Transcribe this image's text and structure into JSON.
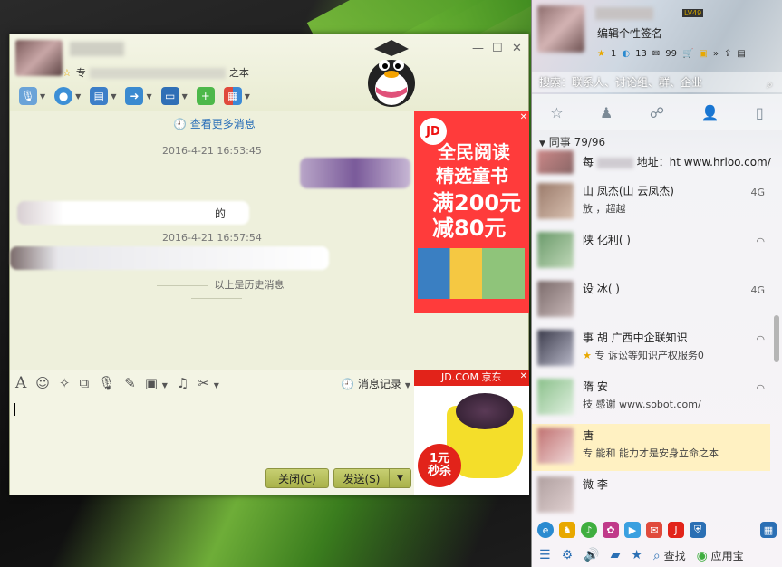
{
  "chat": {
    "signature_prefix": "专",
    "signature_suffix": "之本",
    "more_messages": "查看更多消息",
    "timestamps": [
      "2016-4-21 16:53:45",
      "2016-4-21 16:57:54"
    ],
    "received_fragment": "的",
    "history_divider": "以上是历史消息",
    "message_record": "消息记录",
    "close_label": "关闭(C)",
    "send_label": "发送(S)"
  },
  "ads": {
    "ad1": {
      "logo": "JD",
      "line1": "全民阅读",
      "line2": "精选童书",
      "line3": "满200元",
      "line4": "减80元"
    },
    "ad2": {
      "header": "JD.COM 京东",
      "badge_line1": "1元",
      "badge_line2": "秒杀"
    }
  },
  "qq": {
    "level_badge": "LV49",
    "signature": "编辑个性签名",
    "stats": [
      "1",
      "13",
      "99"
    ],
    "search_placeholder": "搜索：联系人、讨论组、群、企业",
    "group_name": "同事",
    "group_count": "79/96",
    "friends": [
      {
        "name": "每",
        "sig": "地址：ht     www.hrloo.com/",
        "net": ""
      },
      {
        "name": "山    凤杰(山    云凤杰)",
        "sig": "放    ，超越",
        "net": "4G"
      },
      {
        "name": "陕    化利(   )",
        "sig": "",
        "net": "wifi"
      },
      {
        "name": "设    冰(   )",
        "sig": "",
        "net": "4G"
      },
      {
        "name": "事    胡    广西中企联知识",
        "sig": "专    诉讼等知识产权服务0",
        "net": "wifi"
      },
      {
        "name": "隋    安",
        "sig": "技    感谢    www.sobot.com/",
        "net": "wifi"
      },
      {
        "name": "唐",
        "sig": "专    能和    能力才是安身立命之本",
        "net": ""
      },
      {
        "name": "微    李",
        "sig": "",
        "net": ""
      }
    ],
    "bottom_find": "查找",
    "bottom_appstore": "应用宝"
  }
}
